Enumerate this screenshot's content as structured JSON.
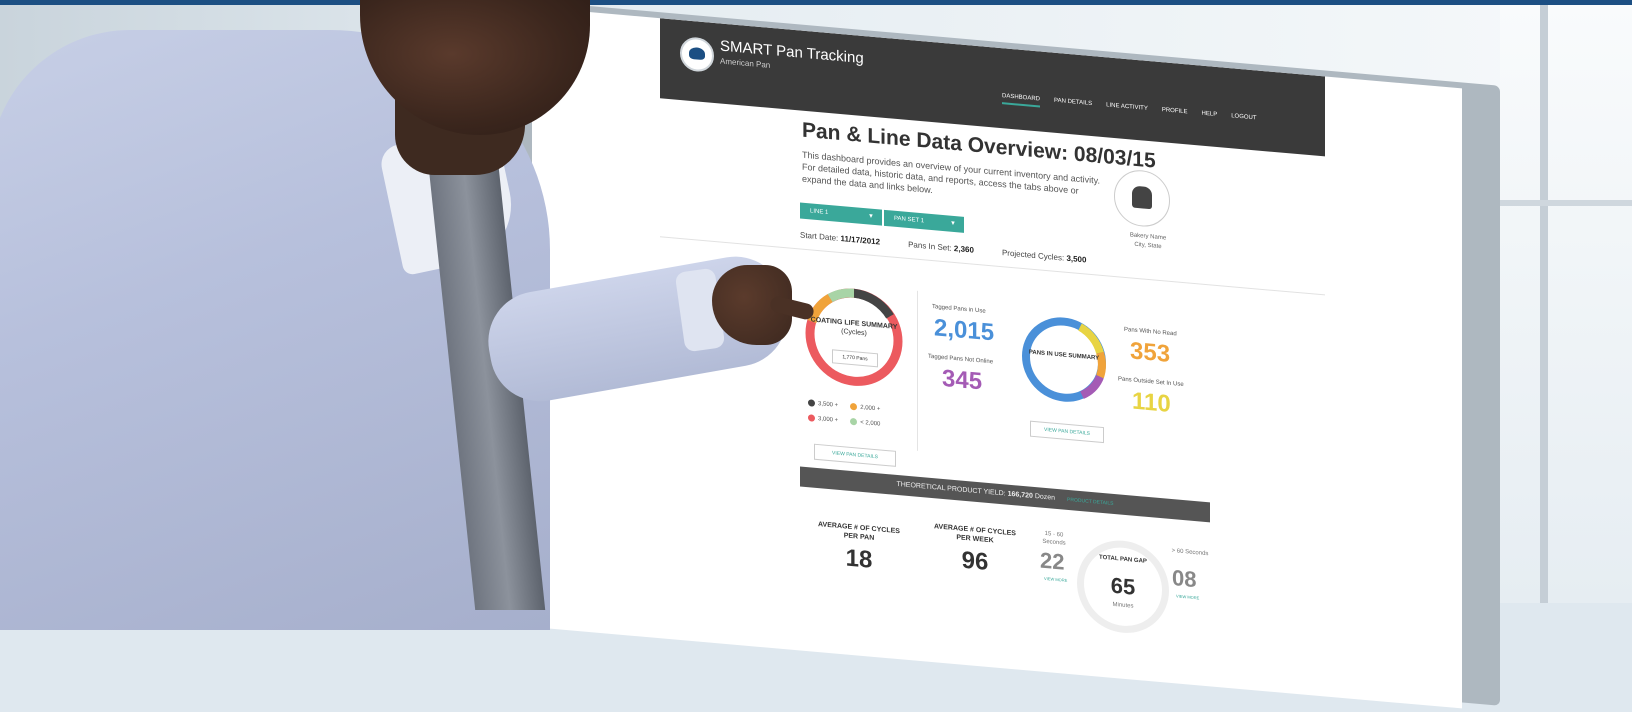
{
  "app": {
    "title": "SMART Pan Tracking",
    "subtitle": "American Pan",
    "nav": [
      "DASHBOARD",
      "PAN DETAILS",
      "LINE ACTIVITY",
      "PROFILE",
      "HELP",
      "LOGOUT"
    ]
  },
  "overview": {
    "title": "Pan & Line Data Overview: 08/03/15",
    "description": "This dashboard provides an overview of your current inventory and activity. For detailed data, historic data, and reports, access the tabs above or expand the data and links below.",
    "line_label": "LINE 1",
    "panset_label": "PAN SET 1",
    "bakery_name": "Bakery Name",
    "bakery_location": "City, State"
  },
  "stats": {
    "start_date_label": "Start Date:",
    "start_date": "11/17/2012",
    "pans_in_set_label": "Pans In Set:",
    "pans_in_set": "2,360",
    "projected_cycles_label": "Projected Cycles:",
    "projected_cycles": "3,500"
  },
  "coating": {
    "title": "COATING LIFE SUMMARY",
    "subtitle": "(Cycles)",
    "tag": "1,770 Pans",
    "legend": [
      {
        "label": "3,500 +",
        "color": "#444444"
      },
      {
        "label": "2,000 +",
        "color": "#f0a33a"
      },
      {
        "label": "3,000 +",
        "color": "#ec5a5f"
      },
      {
        "label": "< 2,000",
        "color": "#a8d4a6"
      }
    ],
    "view_btn": "VIEW PAN DETAILS"
  },
  "tagged": {
    "in_use_label": "Tagged Pans in Use",
    "in_use_value": "2,015",
    "not_online_label": "Tagged Pans Not Online",
    "not_online_value": "345"
  },
  "pans_in_use": {
    "title": "PANS IN USE SUMMARY",
    "no_read_label": "Pans With No Read",
    "no_read_value": "353",
    "outside_label": "Pans Outside Set In Use",
    "outside_value": "110",
    "view_btn": "VIEW PAN DETAILS"
  },
  "yield": {
    "label": "THEORETICAL PRODUCT YIELD:",
    "value": "166,720",
    "unit": "Dozen",
    "link": "PRODUCT DETAILS"
  },
  "bottom": {
    "avg_cycles_pan_label": "AVERAGE # OF CYCLES PER PAN",
    "avg_cycles_pan": "18",
    "avg_cycles_week_label": "AVERAGE # OF CYCLES PER WEEK",
    "avg_cycles_week": "96",
    "gap_left_label": "15 - 60 Seconds",
    "gap_left_value": "22",
    "gap_total_label": "TOTAL PAN GAP",
    "gap_total_value": "65",
    "gap_total_unit": "Minutes",
    "gap_right_label": "> 60 Seconds",
    "gap_right_value": "08",
    "view_more": "VIEW MORE"
  },
  "colors": {
    "accent": "#3aa89a",
    "blue": "#4a90d9",
    "purple": "#a45bb5",
    "orange": "#f0a33a",
    "yellow": "#e8d443",
    "red": "#ec5a5f"
  }
}
